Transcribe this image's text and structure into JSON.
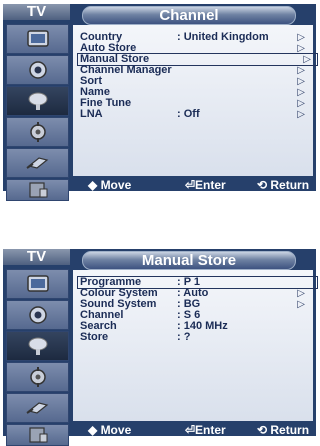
{
  "screens": [
    {
      "tab": "TV",
      "title": "Channel",
      "rows": [
        {
          "label": "Country",
          "value": ": United Kingdom",
          "arrow": "▷"
        },
        {
          "label": "Auto Store",
          "value": "",
          "arrow": "▷"
        },
        {
          "label": "Manual Store",
          "value": "",
          "arrow": "▷"
        },
        {
          "label": "Channel Manager",
          "value": "",
          "arrow": "▷"
        },
        {
          "label": "Sort",
          "value": "",
          "arrow": "▷"
        },
        {
          "label": "Name",
          "value": "",
          "arrow": "▷"
        },
        {
          "label": "Fine Tune",
          "value": "",
          "arrow": "▷"
        },
        {
          "label": "LNA",
          "value": ": Off",
          "arrow": "▷"
        }
      ],
      "footer": {
        "move": "◆ Move",
        "enter": "⏎Enter",
        "return": "⟲ Return"
      }
    },
    {
      "tab": "TV",
      "title": "Manual Store",
      "rows": [
        {
          "label": "Programme",
          "value": ": P 1",
          "arrow": ""
        },
        {
          "label": "Colour System",
          "value": ": Auto",
          "arrow": "▷"
        },
        {
          "label": "Sound System",
          "value": ": BG",
          "arrow": "▷"
        },
        {
          "label": "Channel",
          "value": ": S 6",
          "arrow": ""
        },
        {
          "label": "Search",
          "value": ": 140 MHz",
          "arrow": ""
        },
        {
          "label": "Store",
          "value": ": ?",
          "arrow": ""
        }
      ],
      "footer": {
        "move": "◆ Move",
        "enter": "⏎Enter",
        "return": "⟲ Return"
      }
    }
  ],
  "sidebar_icons": [
    "picture-icon",
    "sound-icon",
    "channel-icon",
    "setup-icon",
    "input-icon",
    "application-icon"
  ],
  "colors": {
    "background": "#26406b",
    "panel": "#e8ecf3",
    "text": "#1b2c56"
  }
}
